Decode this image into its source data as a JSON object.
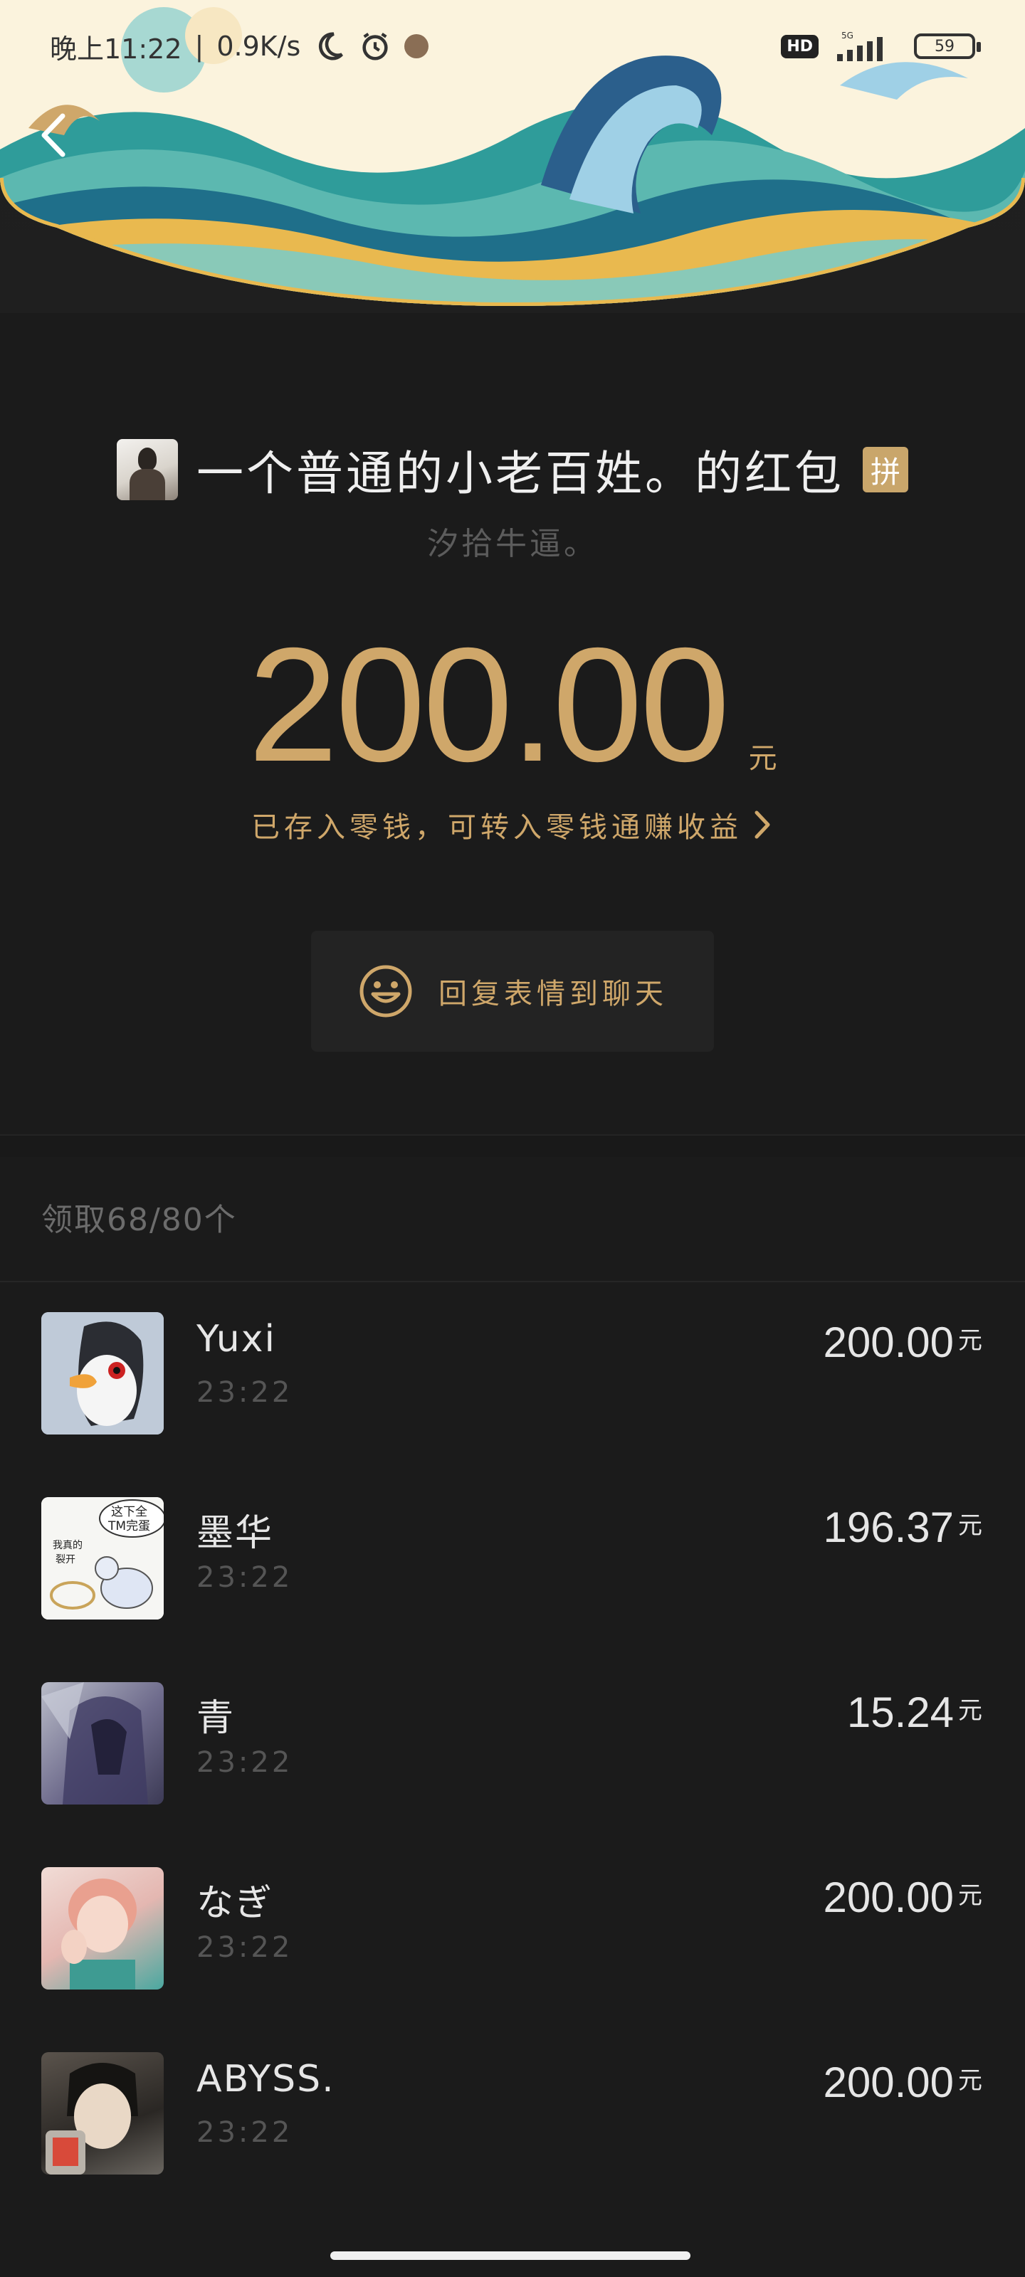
{
  "status_bar": {
    "time": "晚上11:22",
    "network_speed": "0.9K/s",
    "hd_label": "HD",
    "signal_label": "5G",
    "battery": "59",
    "icons": [
      "moon-icon",
      "alarm-icon",
      "app-icon",
      "signal-icon",
      "battery-icon"
    ]
  },
  "header": {
    "back_icon": "chevron-left-icon"
  },
  "sender": {
    "title": "一个普通的小老百姓。的红包",
    "badge": "拼",
    "subtitle": "汐拾牛逼。"
  },
  "amount": {
    "value": "200.00",
    "unit": "元",
    "savings_text": "已存入零钱，可转入零钱通赚收益"
  },
  "reply": {
    "label": "回复表情到聊天",
    "icon": "smile-icon"
  },
  "receivers": {
    "count_label": "领取68/80个",
    "items": [
      {
        "name": "Yuxi",
        "time": "23:22",
        "amount": "200.00",
        "unit": "元"
      },
      {
        "name": "墨华",
        "time": "23:22",
        "amount": "196.37",
        "unit": "元"
      },
      {
        "name": "青",
        "time": "23:22",
        "amount": "15.24",
        "unit": "元"
      },
      {
        "name": "なぎ",
        "time": "23:22",
        "amount": "200.00",
        "unit": "元"
      },
      {
        "name": "ABYSS.",
        "time": "23:22",
        "amount": "200.00",
        "unit": "元"
      }
    ]
  },
  "avatar_2_text": [
    "这下全",
    "TM完蛋",
    "我真的",
    "裂开"
  ],
  "colors": {
    "background": "#1b1b1b",
    "gold": "#cfa76a",
    "badge": "#c9a66b"
  }
}
